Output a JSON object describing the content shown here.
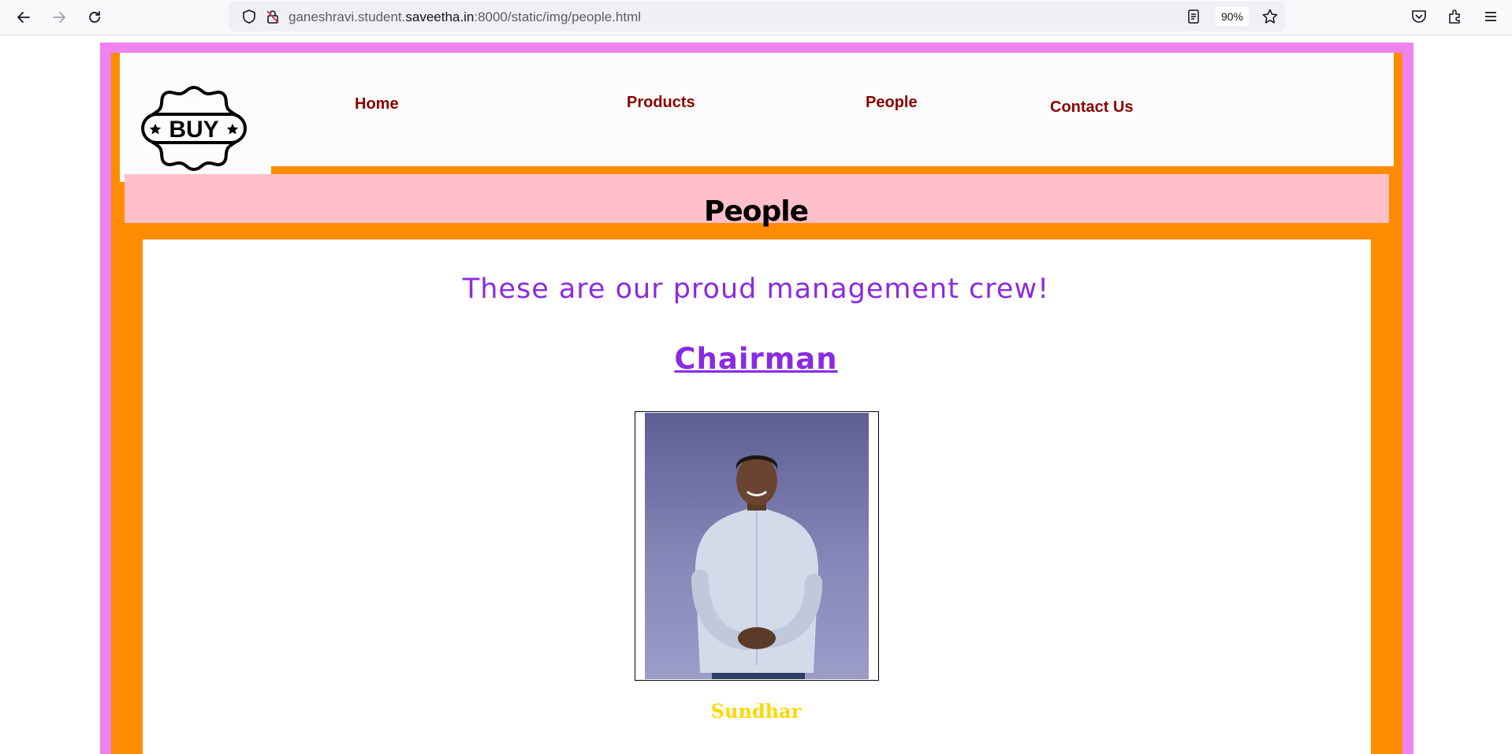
{
  "browser": {
    "url_prefix": "ganeshravi.student.",
    "url_domain": "saveetha.in",
    "url_suffix": ":8000/static/img/people.html",
    "zoom": "90%"
  },
  "logo": {
    "text": "BUY"
  },
  "nav": {
    "home": "Home",
    "products": "Products",
    "people": "People",
    "contact": "Contact Us"
  },
  "page": {
    "title": "People",
    "crew_heading": "These are our proud management crew!",
    "role": "Chairman",
    "person_name": "Sundhar"
  },
  "colors": {
    "outer_border": "#ee82ee",
    "frame": "#ff8c00",
    "title_band": "#ffc0cb",
    "nav_link": "#8b0000",
    "heading": "#8a2be2",
    "name": "#ffd700"
  }
}
